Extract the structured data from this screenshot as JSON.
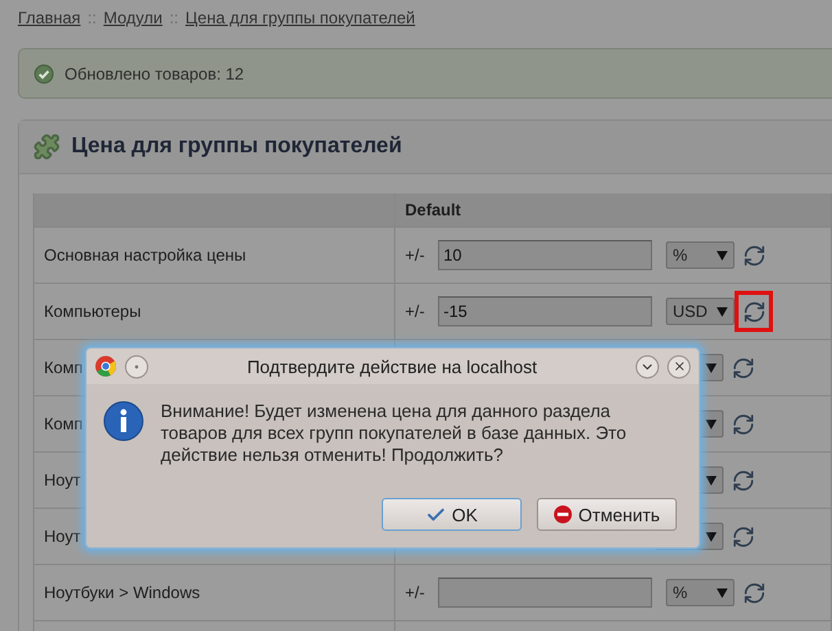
{
  "breadcrumb": {
    "separator": "::",
    "items": [
      {
        "label": "Главная"
      },
      {
        "label": "Модули"
      },
      {
        "label": "Цена для группы покупателей"
      }
    ]
  },
  "notice": {
    "kind": "success",
    "text": "Обновлено товаров: 12"
  },
  "panel": {
    "title": "Цена для группы покупателей",
    "columns": [
      "Default"
    ],
    "rows": [
      {
        "kind": "full",
        "label": "Основная настройка цены",
        "prefix": "+/-",
        "value": "10",
        "unit": "%",
        "highlighted": false
      },
      {
        "kind": "full",
        "label": "Компьютеры",
        "prefix": "+/-",
        "value": "-15",
        "unit": "USD",
        "highlighted": true
      },
      {
        "kind": "covered",
        "label": "Комп",
        "highlighted": false
      },
      {
        "kind": "covered",
        "label": "Комп",
        "highlighted": false
      },
      {
        "kind": "covered",
        "label": "Ноут",
        "highlighted": false
      },
      {
        "kind": "covered",
        "label": "Ноут",
        "highlighted": false
      },
      {
        "kind": "full",
        "label": "Ноутбуки > Windows",
        "prefix": "+/-",
        "unit": "%",
        "highlighted": false
      }
    ]
  },
  "dialog": {
    "title": "Подтвердите действие на localhost",
    "message": "Внимание! Будет изменена цена для данного раздела товаров для всех групп покупателей в базе данных. Это действие нельзя отменить! Продолжить?",
    "buttons": [
      {
        "kind": "confirm",
        "label": "OK",
        "focused": true
      },
      {
        "kind": "cancel",
        "label": "Отменить",
        "focused": false
      }
    ]
  }
}
